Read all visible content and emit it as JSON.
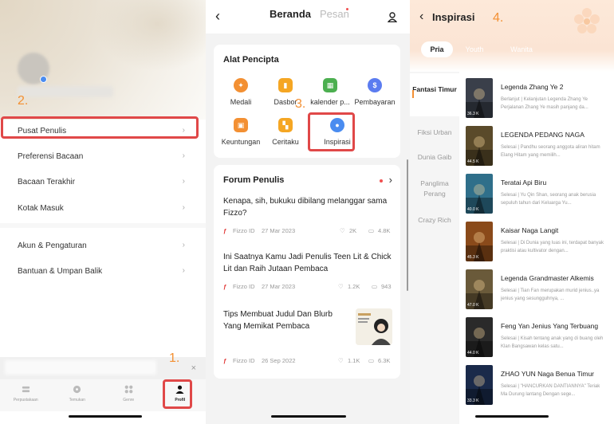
{
  "annotations": [
    "1.",
    "2.",
    "3.",
    "4."
  ],
  "profile": {
    "menu": [
      {
        "label": "Pusat Penulis"
      },
      {
        "label": "Preferensi Bacaan"
      },
      {
        "label": "Bacaan Terakhir"
      },
      {
        "label": "Kotak Masuk"
      },
      {
        "label": "Akun & Pengaturan"
      },
      {
        "label": "Bantuan & Umpan Balik"
      }
    ],
    "tabbar": [
      {
        "label": "Perpustakaan",
        "icon": "library-icon"
      },
      {
        "label": "Temukan",
        "icon": "compass-icon"
      },
      {
        "label": "Genre",
        "icon": "grid-icon"
      },
      {
        "label": "Profil",
        "icon": "profile-icon"
      }
    ],
    "ad_close": "×"
  },
  "beranda": {
    "back": "‹",
    "tab_active": "Beranda",
    "tab_inactive": "Pesan",
    "tools_title": "Alat Pencipta",
    "tools": [
      {
        "label": "Medali",
        "color": "#f39033",
        "glyph": "✦"
      },
      {
        "label": "Dasbor",
        "color": "#f5a623",
        "glyph": "▮"
      },
      {
        "label": "kalender p...",
        "color": "#4caf50",
        "glyph": "▦"
      },
      {
        "label": "Pembayaran",
        "color": "#5b7cf0",
        "glyph": "$"
      },
      {
        "label": "Keuntungan",
        "color": "#f39033",
        "glyph": "▣"
      },
      {
        "label": "Ceritaku",
        "color": "#f5a623",
        "glyph": "▚"
      },
      {
        "label": "Inspirasi",
        "color": "#4a8cf0",
        "glyph": "●"
      }
    ],
    "forum_title": "Forum Penulis",
    "forum_arrow": "›",
    "posts": [
      {
        "title": "Kenapa, sih, bukuku dibilang melanggar sama Fizzo?",
        "author": "Fizzo ID",
        "date": "27 Mar 2023",
        "likes": "2K",
        "comments": "4.8K"
      },
      {
        "title": "Ini Saatnya Kamu Jadi Penulis Teen Lit & Chick Lit dan Raih Jutaan Pembaca",
        "author": "Fizzo ID",
        "date": "27 Mar 2023",
        "likes": "1.2K",
        "comments": "943"
      },
      {
        "title": "Tips Membuat Judul Dan Blurb Yang Memikat Pembaca",
        "author": "Fizzo ID",
        "date": "26 Sep 2022",
        "likes": "1.1K",
        "comments": "6.3K"
      }
    ]
  },
  "inspirasi": {
    "back": "‹",
    "title": "Inspirasi",
    "pills": [
      {
        "label": "Pria",
        "active": true
      },
      {
        "label": "Youth",
        "active": false
      },
      {
        "label": "Wanita",
        "active": false
      }
    ],
    "categories": [
      "Fantasi Timur",
      "Fiksi Urban",
      "Dunia Gaib",
      "Panglima Perang",
      "Crazy Rich"
    ],
    "books": [
      {
        "title": "Legenda Zhang Ye 2",
        "desc": "Berlanjut | Kelanjutan Legenda Zhang Ye Perjalanan Zhang Ye masih panjang da...",
        "views": "36.3 K",
        "color": "#3a3f4a"
      },
      {
        "title": "LEGENDA PEDANG NAGA",
        "desc": "Selesai | Pandhu seorang anggota aliran hitam Elang Hitam yang memilih...",
        "views": "44.5 K",
        "color": "#5a4a2a"
      },
      {
        "title": "Teratai Api Biru",
        "desc": "Selesai | Yu Qin Shan, seorang anak berusia sepuluh tahun dari Keluarga Yu...",
        "views": "40.0 K",
        "color": "#2f6f8a"
      },
      {
        "title": "Kaisar Naga Langit",
        "desc": "Selesai | Di Dunia yang luas ini, terdapat banyak praktisi atau kultivator dengan...",
        "views": "45.3 K",
        "color": "#8a4a1a"
      },
      {
        "title": "Legenda Grandmaster Alkemis",
        "desc": "Selesai | Tian Fan merupakan murid jenius..ya jenius yang sesungguhnya, ...",
        "views": "47.0 K",
        "color": "#6a5a3a"
      },
      {
        "title": "Feng Yan Jenius Yang Terbuang",
        "desc": "Selesai | Kisah tentang anak yang di buang oleh Klan Bangsawan kelas satu...",
        "views": "44.0 K",
        "color": "#2a2a2a"
      },
      {
        "title": "ZHAO YUN Naga Benua Timur",
        "desc": "Selesai | \"HANCURKAN DANTIANNYA\" Teriak Ma Durung lantang Dengan sege...",
        "views": "33.3 K",
        "color": "#1a2a4a"
      }
    ]
  }
}
